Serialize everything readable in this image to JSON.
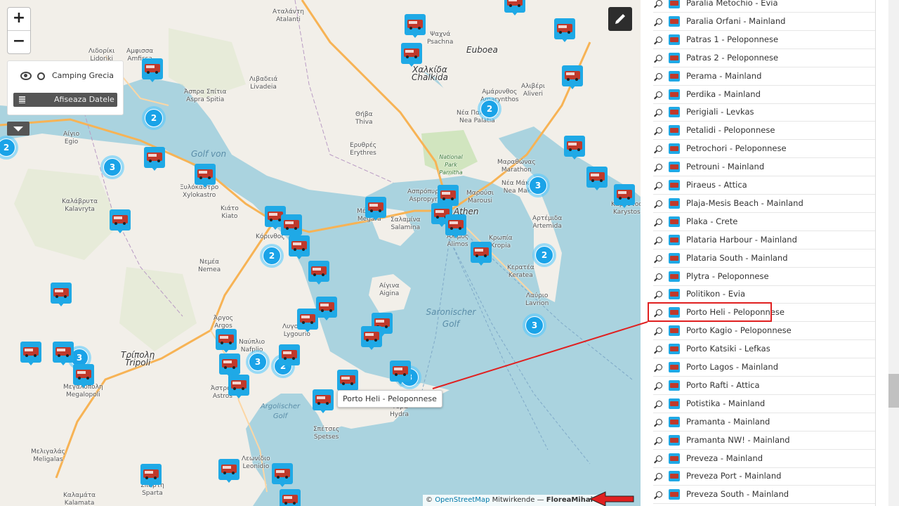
{
  "map": {
    "zoom_in": "+",
    "zoom_out": "−",
    "layer_name": "Camping Grecia",
    "data_button": "Afiseaza Datele",
    "tooltip": "Porto Heli - Peloponnese",
    "attribution": {
      "prefix": "©",
      "link": "OpenStreetMap",
      "contrib": "Mitwirkende —",
      "author": "FloreaMihai",
      "suffix": "—"
    },
    "places": [
      {
        "text": "Αταλάντη",
        "sub": "Atalanti"
      },
      {
        "text": "Λιβαδειά",
        "sub": "Livadeia"
      },
      {
        "text": "Άσπρα Σπίτια",
        "sub": "Aspra Spitia"
      },
      {
        "text": "Αμφισσα",
        "sub": "Amfissa"
      },
      {
        "text": "Λιδορίκι",
        "sub": "Lidoriki"
      },
      {
        "text": "Αίγιο",
        "sub": "Egio"
      },
      {
        "text": "Καλάβρυτα",
        "sub": "Kalavryta"
      },
      {
        "text": "Ξυλόκαστρο",
        "sub": "Xylokastro"
      },
      {
        "text": "Κιάτο",
        "sub": "Kiato"
      },
      {
        "text": "Κόρινθος",
        "sub": "Korinth"
      },
      {
        "text": "Νεμέα",
        "sub": "Nemea"
      },
      {
        "text": "Άργος",
        "sub": "Argos"
      },
      {
        "text": "Ναύπλιο",
        "sub": "Nafplio"
      },
      {
        "text": "Τρίπολη",
        "sub": "Tripoli"
      },
      {
        "text": "Μεγαλόπολη",
        "sub": "Megalopoli"
      },
      {
        "text": "Μελιγαλάς",
        "sub": "Meligalas"
      },
      {
        "text": "Σπάρτη",
        "sub": "Sparta"
      },
      {
        "text": "Καλαμάτα",
        "sub": "Kalamata"
      },
      {
        "text": "Λεωνίδιο",
        "sub": "Leonidio"
      },
      {
        "text": "Άστρος",
        "sub": "Astros"
      },
      {
        "text": "Λυγουριό",
        "sub": "Lygourio"
      },
      {
        "text": "Σπέτσες",
        "sub": "Spetses"
      },
      {
        "text": "Ύδρα",
        "sub": "Hydra"
      },
      {
        "text": "Αίγινα",
        "sub": "Aigina"
      },
      {
        "text": "Σαλαμίνα",
        "sub": "Salamina"
      },
      {
        "text": "Μέγαρα",
        "sub": "Megara"
      },
      {
        "text": "Ασπρόπυργος",
        "sub": "Aspropyrgos"
      },
      {
        "text": "Μαρούσι",
        "sub": "Marousi"
      },
      {
        "text": "Athen",
        "sub": ""
      },
      {
        "text": "Άλιμος",
        "sub": "Alimos"
      },
      {
        "text": "Κρωπία",
        "sub": "Kropia"
      },
      {
        "text": "Αρτέμιδα",
        "sub": "Artemida"
      },
      {
        "text": "Κερατέα",
        "sub": "Keratea"
      },
      {
        "text": "Λαύριο",
        "sub": "Lavrion"
      },
      {
        "text": "Νέα Μάκρη",
        "sub": "Nea Makri"
      },
      {
        "text": "Μαραθώνας",
        "sub": "Marathon"
      },
      {
        "text": "Ερυθρές",
        "sub": "Erythres"
      },
      {
        "text": "Θήβα",
        "sub": "Thiva"
      },
      {
        "text": "Χαλκίδα",
        "sub": "Chalkida"
      },
      {
        "text": "Ψαχνά",
        "sub": "Psachna"
      },
      {
        "text": "Νέα Παλάτια",
        "sub": "Nea Palatia"
      },
      {
        "text": "Αμάρυνθος",
        "sub": "Amarynthos"
      },
      {
        "text": "Αλιβέρι",
        "sub": "Aliveri"
      },
      {
        "text": "Κάρυστος",
        "sub": "Karystos"
      }
    ],
    "regions": {
      "euboea": "Euboea",
      "park": "National Park Parnitha",
      "golf_von": "Golf von",
      "saronic": "Saronischer Golf",
      "argolic": "Argolischer Golf"
    },
    "clusters": [
      "2",
      "2",
      "3",
      "2",
      "3",
      "2",
      "2",
      "3",
      "3",
      "3",
      "2",
      "3"
    ]
  },
  "list": {
    "items": [
      "Paralia Metochio - Evia",
      "Paralia Orfani - Mainland",
      "Patras 1 - Peloponnese",
      "Patras 2 - Peloponnese",
      "Perama - Mainland",
      "Perdika - Mainland",
      "Perigiali - Levkas",
      "Petalidi - Peloponnese",
      "Petrochori - Peloponnese",
      "Petrouni - Mainland",
      "Piraeus - Attica",
      "Plaja-Mesis Beach - Mainland",
      "Plaka - Crete",
      "Plataria Harbour - Mainland",
      "Plataria South - Mainland",
      "Plytra - Peloponnese",
      "Politikon - Evia",
      "Porto Heli - Peloponnese",
      "Porto Kagio - Peloponnese",
      "Porto Katsiki - Lefkas",
      "Porto Lagos - Mainland",
      "Porto Rafti - Attica",
      "Potistika - Mainland",
      "Pramanta - Mainland",
      "Pramanta NW! - Mainland",
      "Preveza - Mainland",
      "Preveza Port - Mainland",
      "Preveza South - Mainland"
    ],
    "highlighted_index": 17
  },
  "colors": {
    "sea": "#aad3df",
    "land": "#f2efe9",
    "accent": "#1fa9e6",
    "highlight": "#e02020"
  }
}
